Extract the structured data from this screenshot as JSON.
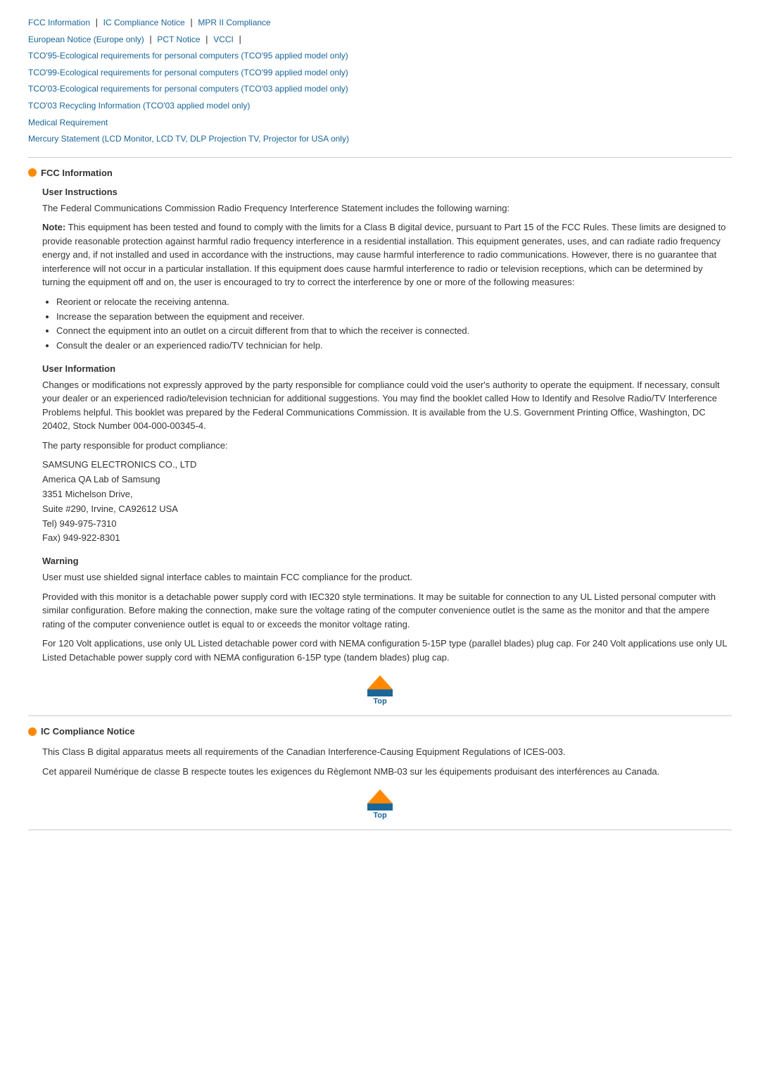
{
  "nav": {
    "links": [
      {
        "label": "FCC Information",
        "href": "#fcc"
      },
      {
        "label": "IC Compliance Notice",
        "href": "#ic"
      },
      {
        "label": "MPR II Compliance",
        "href": "#mpr"
      },
      {
        "label": "European Notice (Europe only)",
        "href": "#european"
      },
      {
        "label": "PCT Notice",
        "href": "#pct"
      },
      {
        "label": "VCCI",
        "href": "#vcci"
      },
      {
        "label": "TCO'95-Ecological requirements for personal computers (TCO'95 applied model only)",
        "href": "#tco95"
      },
      {
        "label": "TCO'99-Ecological requirements for personal computers (TCO'99 applied model only)",
        "href": "#tco99"
      },
      {
        "label": "TCO'03-Ecological requirements for personal computers (TCO'03 applied model only)",
        "href": "#tco03"
      },
      {
        "label": "TCO'03 Recycling Information (TCO'03 applied model only)",
        "href": "#tco03r"
      },
      {
        "label": "Medical Requirement",
        "href": "#medical"
      },
      {
        "label": "Mercury Statement (LCD Monitor, LCD TV, DLP Projection TV, Projector for USA only)",
        "href": "#mercury"
      }
    ]
  },
  "fcc_section": {
    "title": "FCC Information",
    "user_instructions": {
      "heading": "User Instructions",
      "intro": "The Federal Communications Commission Radio Frequency Interference Statement includes the following warning:",
      "note_bold": "Note:",
      "note_text": " This equipment has been tested and found to comply with the limits for a Class B digital device, pursuant to Part 15 of the FCC Rules. These limits are designed to provide reasonable protection against harmful radio frequency interference in a residential installation. This equipment generates, uses, and can radiate radio frequency energy and, if not installed and used in accordance with the instructions, may cause harmful interference to radio communications. However, there is no guarantee that interference will not occur in a particular installation. If this equipment does cause harmful interference to radio or television receptions, which can be determined by turning the equipment off and on, the user is encouraged to try to correct the interference by one or more of the following measures:",
      "bullets": [
        "Reorient or relocate the receiving antenna.",
        "Increase the separation between the equipment and receiver.",
        "Connect the equipment into an outlet on a circuit different from that to which the receiver is connected.",
        "Consult the dealer or an experienced radio/TV technician for help."
      ]
    },
    "user_information": {
      "heading": "User Information",
      "text1": "Changes or modifications not expressly approved by the party responsible for compliance could void the user's authority to operate the equipment. If necessary, consult your dealer or an experienced radio/television technician for additional suggestions. You may find the booklet called How to Identify and Resolve Radio/TV Interference Problems helpful. This booklet was prepared by the Federal Communications Commission. It is available from the U.S. Government Printing Office, Washington, DC 20402, Stock Number 004-000-00345-4.",
      "text2": "The party responsible for product compliance:",
      "address": "SAMSUNG ELECTRONICS CO., LTD\nAmerica QA Lab of Samsung\n3351 Michelson Drive,\nSuite #290, Irvine, CA92612 USA\nTel) 949-975-7310\nFax) 949-922-8301"
    },
    "warning": {
      "heading": "Warning",
      "text1": "User must use shielded signal interface cables to maintain FCC compliance for the product.",
      "text2": "Provided with this monitor is a detachable power supply cord with IEC320 style terminations. It may be suitable for connection to any UL Listed personal computer with similar configuration. Before making the connection, make sure the voltage rating of the computer convenience outlet is the same as the monitor and that the ampere rating of the computer convenience outlet is equal to or exceeds the monitor voltage rating.",
      "text3": "For 120 Volt applications, use only UL Listed detachable power cord with NEMA configuration 5-15P type (parallel blades) plug cap. For 240 Volt applications use only UL Listed Detachable power supply cord with NEMA configuration 6-15P type (tandem blades) plug cap."
    },
    "top_button_label": "Top"
  },
  "ic_section": {
    "title": "IC Compliance Notice",
    "text1": "This Class B digital apparatus meets all requirements of the Canadian Interference-Causing Equipment Regulations of ICES-003.",
    "text2": "Cet appareil Numérique de classe B respecte toutes les exigences du Règlemont NMB-03 sur les équipements produisant des interférences au Canada.",
    "top_button_label": "Top"
  }
}
